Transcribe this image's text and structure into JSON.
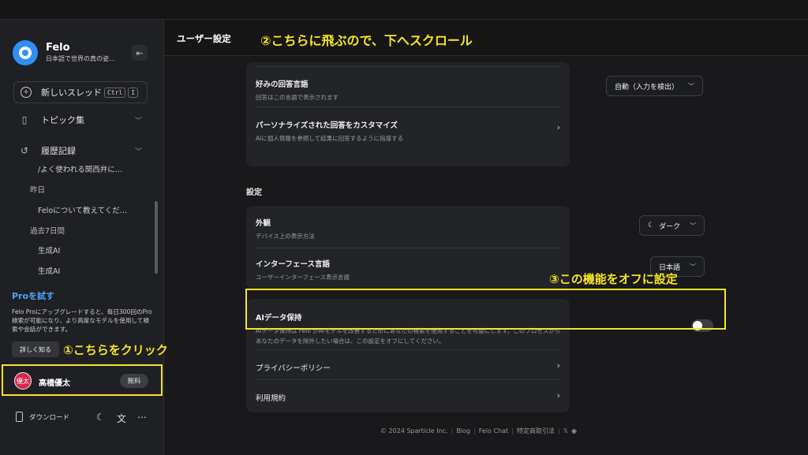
{
  "sidebar": {
    "brand": "Felo",
    "tagline": "日本語で世界の真の姿…",
    "collapse_icon": "collapse-left-icon",
    "new_thread": {
      "label": "新しいスレッド",
      "shortcut_1": "Ctrl",
      "shortcut_2": "I"
    },
    "topics": "トピック集",
    "history": "履歴記録",
    "history_items": [
      {
        "type": "item",
        "text": "/よく使われる関西弁に…"
      },
      {
        "type": "group",
        "text": "昨日"
      },
      {
        "type": "item",
        "text": "Feloについて教えてくだ…"
      },
      {
        "type": "group",
        "text": "過去7日間"
      },
      {
        "type": "item",
        "text": "生成AI"
      },
      {
        "type": "item",
        "text": "生成AI"
      }
    ],
    "pro": {
      "title": "Proを試す",
      "description": "Felo Proにアップグレードすると、毎日300回のPro検索が可能になり、より高度なモデルを使用して検索や会話ができます。",
      "learn_more": "詳しく知る"
    },
    "user": {
      "avatar_text": "優太",
      "name": "高橋優太",
      "plan": "無料"
    },
    "download": "ダウンロード"
  },
  "header": {
    "title": "ユーザー設定"
  },
  "annotations": {
    "step1": "①こちらをクリック",
    "step2": "②こちらに飛ぶので、下へスクロール",
    "step3": "③この機能をオフに設定"
  },
  "settings": {
    "answer_language": {
      "title": "好みの回答言語",
      "subtitle": "回答はこの言語で表示されます",
      "value": "自動（入力を検出）"
    },
    "personalize": {
      "title": "パーソナライズされた回答をカスタマイズ",
      "subtitle": "AIに個人情報を参照して結果に回答するように指導する"
    },
    "section_label": "設定",
    "appearance": {
      "title": "外観",
      "subtitle": "デバイス上の表示方法",
      "value": "ダーク"
    },
    "interface_language": {
      "title": "インターフェース言語",
      "subtitle": "ユーザーインターフェース表示言語",
      "value": "日本語"
    },
    "ai_data": {
      "title": "AIデータ保持",
      "subtitle_1": "AIデータ保持は Felo がAIモデルを改善するためにあなたの検索を使用することを可能にします。このプロセスから",
      "subtitle_2": "あなたのデータを除外したい場合は、この設定をオフにしてください。",
      "enabled": false
    },
    "privacy": "プライバシーポリシー",
    "terms": "利用規約"
  },
  "footer": {
    "copyright": "© 2024 Sparticle Inc.",
    "blog": "Blog",
    "felo_chat": "Felo Chat",
    "legal": "特定商取引法",
    "x": "𝕏",
    "discord": "◉"
  },
  "colors": {
    "accent": "#4ba3ff",
    "highlight": "#f6e524",
    "avatar": "#d8294e"
  }
}
